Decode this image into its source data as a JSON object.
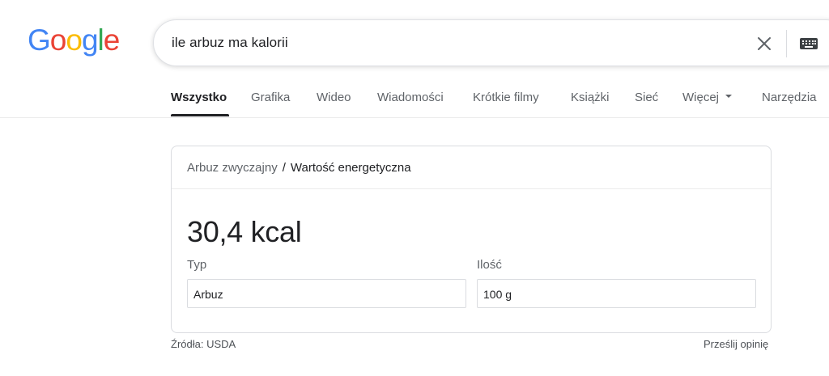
{
  "logo": {
    "letters": [
      "G",
      "o",
      "o",
      "g",
      "l",
      "e"
    ]
  },
  "colors": {
    "google_blue": "#4285F4",
    "google_red": "#EA4335",
    "google_yellow": "#FBBC05",
    "google_green": "#34A853"
  },
  "search": {
    "query": "ile arbuz ma kalorii",
    "clear_icon": "close-icon",
    "keyboard_icon": "keyboard-icon"
  },
  "tabs": [
    {
      "label": "Wszystko",
      "active": true
    },
    {
      "label": "Grafika"
    },
    {
      "label": "Wideo"
    },
    {
      "label": "Wiadomości"
    },
    {
      "label": "Krótkie filmy"
    },
    {
      "label": "Książki"
    },
    {
      "label": "Sieć"
    },
    {
      "label": "Więcej"
    },
    {
      "label": "Narzędzia"
    }
  ],
  "card": {
    "breadcrumb_link": "Arbuz zwyczajny",
    "breadcrumb_sep": "/",
    "breadcrumb_current": "Wartość energetyczna",
    "calories": "30,4 kcal",
    "type_label": "Typ",
    "type_value": "Arbuz",
    "amount_label": "Ilość",
    "amount_value": "100 g"
  },
  "footer": {
    "source": "Źródła: USDA",
    "feedback": "Prześlij opinię"
  }
}
